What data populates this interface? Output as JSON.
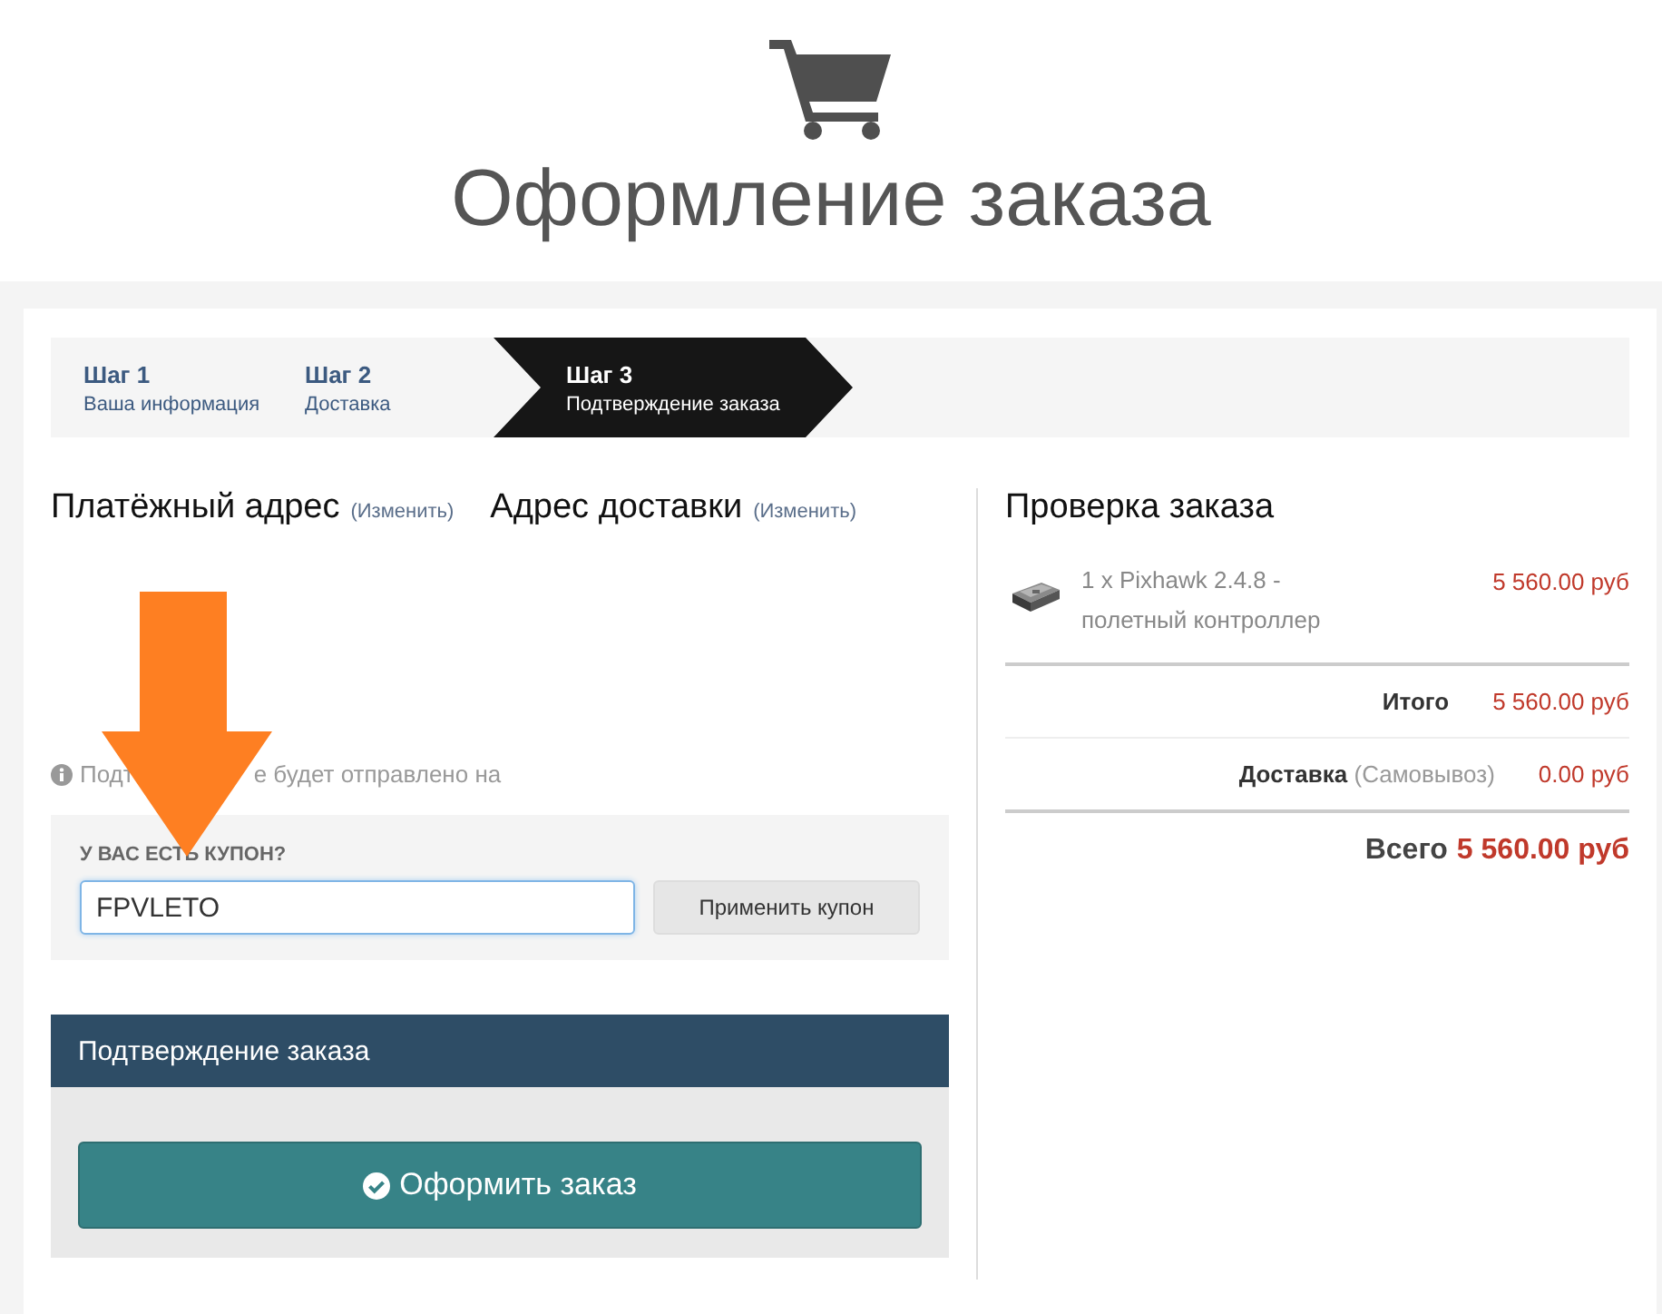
{
  "header": {
    "title": "Оформление заказа"
  },
  "steps": [
    {
      "title": "Шаг 1",
      "subtitle": "Ваша информация",
      "selected": false
    },
    {
      "title": "Шаг 2",
      "subtitle": "Доставка",
      "selected": false
    },
    {
      "title": "Шаг 3",
      "subtitle": "Подтверждение заказа",
      "selected": true
    }
  ],
  "addresses": [
    {
      "heading": "Платёжный адрес",
      "change_link": "(Изменить)"
    },
    {
      "heading": "Адрес доставки",
      "change_link": "(Изменить)"
    }
  ],
  "notice": [
    "Подт",
    "е будет отправлено на"
  ],
  "coupon": {
    "label": "У ВАС ЕСТЬ КУПОН?",
    "value": "FPVLETO",
    "button": "Применить купон"
  },
  "confirm": {
    "title": "Подтверждение заказа",
    "button": "Оформить заказ"
  },
  "review": {
    "title": "Проверка заказа",
    "items": [
      {
        "name": "1 x Pixhawk 2.4.8 - полетный контроллер",
        "price": "5 560.00 руб",
        "kind": "picture"
      }
    ],
    "subtotal": {
      "label": "Итого",
      "value": "5 560.00 руб"
    },
    "shipping": {
      "label": "Доставка",
      "method": "(Самовывоз)",
      "value": "0.00 руб"
    },
    "total": {
      "label": "Всего",
      "value": "5 560.00 руб"
    }
  }
}
